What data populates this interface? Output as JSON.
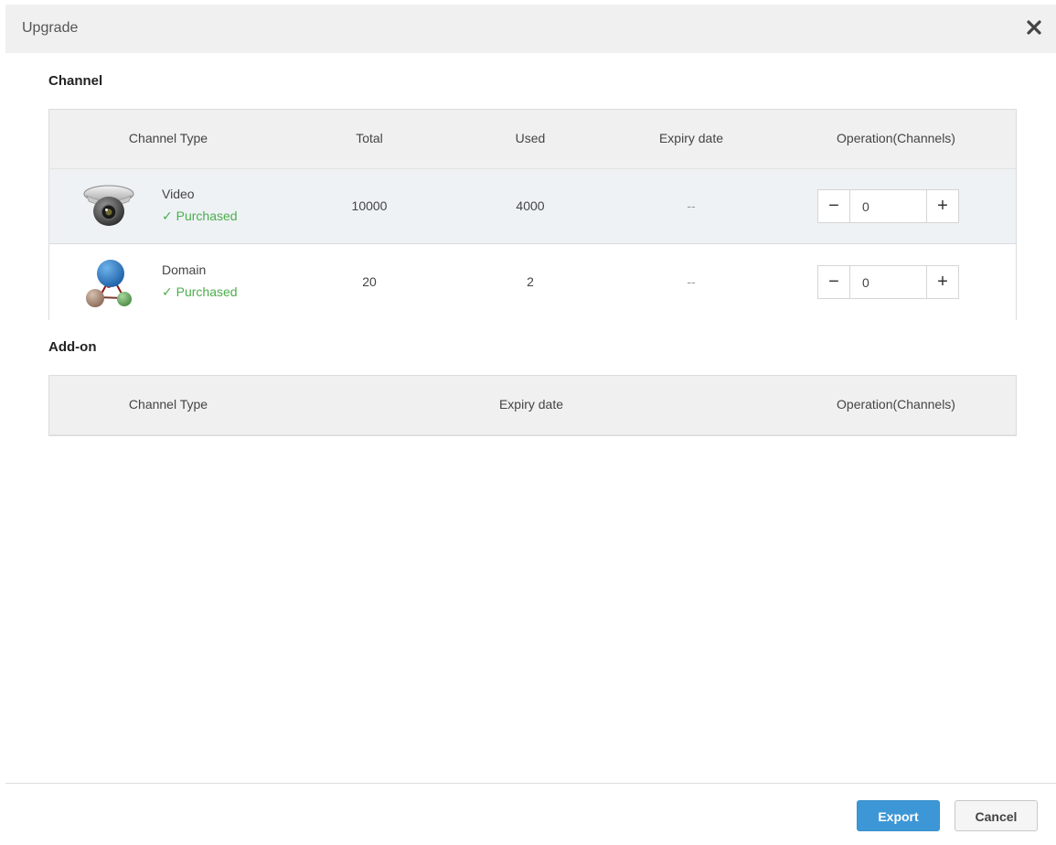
{
  "dialog": {
    "title": "Upgrade",
    "close_icon": "close-icon"
  },
  "channel": {
    "section_title": "Channel",
    "columns": [
      "Channel Type",
      "Total",
      "Used",
      "Expiry date",
      "Operation(Channels)"
    ],
    "rows": [
      {
        "icon": "camera-icon",
        "name": "Video",
        "status": "Purchased",
        "total": "10000",
        "used": "4000",
        "expiry": "--",
        "value": "0"
      },
      {
        "icon": "domain-icon",
        "name": "Domain",
        "status": "Purchased",
        "total": "20",
        "used": "2",
        "expiry": "--",
        "value": "0"
      }
    ],
    "minus_label": "−",
    "plus_label": "+"
  },
  "addon": {
    "section_title": "Add-on",
    "columns": [
      "Channel Type",
      "Expiry date",
      "Operation(Channels)"
    ]
  },
  "footer": {
    "export_label": "Export",
    "cancel_label": "Cancel"
  },
  "colors": {
    "accent": "#3d97d6",
    "purchased": "#4cae4c",
    "header_bg": "#f0f0f0"
  }
}
